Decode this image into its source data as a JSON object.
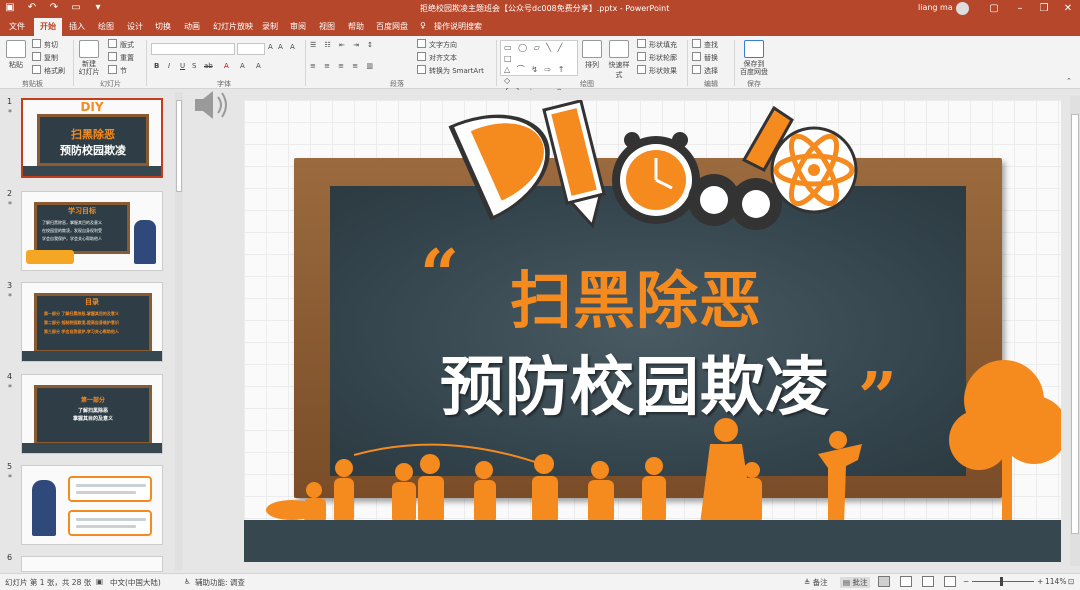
{
  "titlebar": {
    "doc_title": "拒绝校园欺凌主题班会【公众号dc008免费分享】.pptx  -  PowerPoint",
    "user_name": "liang ma"
  },
  "menu": {
    "tabs": [
      "文件",
      "开始",
      "插入",
      "绘图",
      "设计",
      "切换",
      "动画",
      "幻灯片放映",
      "录制",
      "审阅",
      "视图",
      "帮助",
      "百度网盘"
    ],
    "active_tab": "开始",
    "tell_me": "操作说明搜索"
  },
  "ribbon": {
    "clipboard": {
      "paste": "粘贴",
      "cut": "剪切",
      "copy": "复制",
      "format_painter": "格式刷",
      "label": "剪贴板"
    },
    "slides": {
      "new_slide": "新建\n幻灯片",
      "layout": "版式",
      "reset": "重置",
      "section": "节",
      "label": "幻灯片"
    },
    "font": {
      "label": "字体",
      "buttons": [
        "B",
        "I",
        "U",
        "S",
        "ab",
        "A",
        "A",
        "A"
      ]
    },
    "paragraph": {
      "text_direction": "文字方向",
      "align_text": "对齐文本",
      "smartart": "转换为 SmartArt",
      "label": "段落"
    },
    "drawing": {
      "arrange": "排列",
      "quick_styles": "快速样式",
      "shape_fill": "形状填充",
      "shape_outline": "形状轮廓",
      "shape_effects": "形状效果",
      "label": "绘图"
    },
    "editing": {
      "find": "查找",
      "replace": "替换",
      "select": "选择",
      "label": "编辑"
    },
    "save": {
      "button": "保存到\n百度网盘",
      "label": "保存"
    }
  },
  "thumbnails": [
    {
      "num": "1",
      "title": "扫黑除恶",
      "subtitle": "预防校园欺凌"
    },
    {
      "num": "2",
      "title": "学习目标",
      "lines": [
        "了解扫黑除恶，掌握其目的及意义",
        "在校园里的欺凌，发现自身权利受",
        "学会自我保护，学会关心帮助他人"
      ]
    },
    {
      "num": "3",
      "title": "目录",
      "lines": [
        "第一部分  了解扫黑除恶,掌握其目的及意义",
        "第二部分  抵制校园欺凌,提高自身维护意识",
        "第三部分  学会自我保护,学习关心帮助他人"
      ]
    },
    {
      "num": "4",
      "title": "第一部分",
      "lines": [
        "了解扫黑除恶",
        "掌握其目的及意义"
      ]
    },
    {
      "num": "5"
    },
    {
      "num": "6"
    }
  ],
  "slide": {
    "headline_orange": "扫黑除恶",
    "headline_white": "预防校园欺凌",
    "quote_open": "“",
    "quote_close": "”",
    "deco_letters": "DIY"
  },
  "statusbar": {
    "slide_info": "幻灯片 第 1 张，共 28 张",
    "language": "中文(中国大陆)",
    "accessibility": "辅助功能: 调查",
    "notes": "备注",
    "comments": "批注",
    "zoom": "114%"
  },
  "colors": {
    "accent": "#b7472a",
    "orange": "#f58a1f",
    "board": "#33434b",
    "frame": "#8a5a30"
  }
}
